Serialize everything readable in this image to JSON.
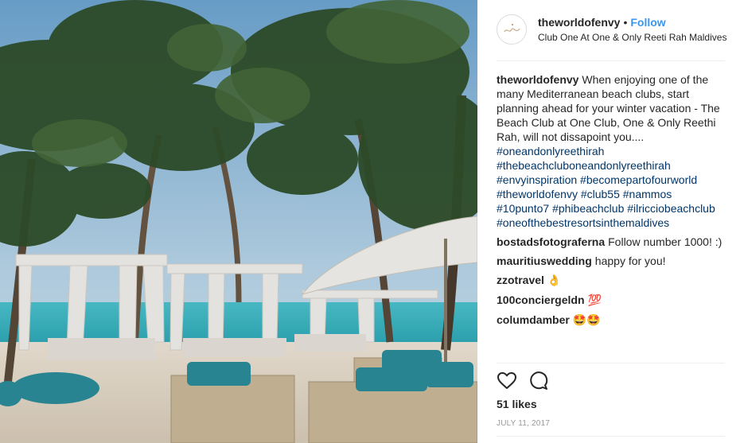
{
  "post": {
    "photo_icon": "beach-club-photo",
    "username": "theworldofenvy",
    "separator": "•",
    "follow_label": "Follow",
    "location": "Club One At One & Only Reeti Rah Maldives"
  },
  "caption": {
    "user": "theworldofenvy",
    "text": "When enjoying one of the many Mediterranean beach clubs, start planning ahead for your winter vacation - The Beach Club at One Club, One & Only Reethi Rah, will not dissapoint you....",
    "tags": [
      "#oneandonlyreethirah",
      "#thebeachcluboneandonlyreethirah",
      "#envyinspiration #becomepartofourworld",
      "#theworldofenvy #club55 #nammos",
      "#10punto7 #phibeachclub #ilricciobeachclub",
      "#oneofthebestresortsinthemaldives"
    ]
  },
  "comments": [
    {
      "user": "bostadsfotograferna",
      "text": "Follow number 1000! :)",
      "emoji": ""
    },
    {
      "user": "mauritiuswedding",
      "text": "happy for you!",
      "emoji": ""
    },
    {
      "user": "zzotravel",
      "text": "",
      "emoji": "👌"
    },
    {
      "user": "100conciergeldn",
      "text": "",
      "emoji": "💯"
    },
    {
      "user": "columdamber",
      "text": "",
      "emoji": "🤩🤩"
    }
  ],
  "actions": {
    "like_icon": "heart-icon",
    "comment_icon": "comment-bubble-icon"
  },
  "likes": "51 likes",
  "date": "JULY 11, 2017",
  "colors": {
    "link": "#3897f0",
    "hashtag": "#003569",
    "text": "#262626",
    "muted": "#999999",
    "divider": "#efefef"
  }
}
